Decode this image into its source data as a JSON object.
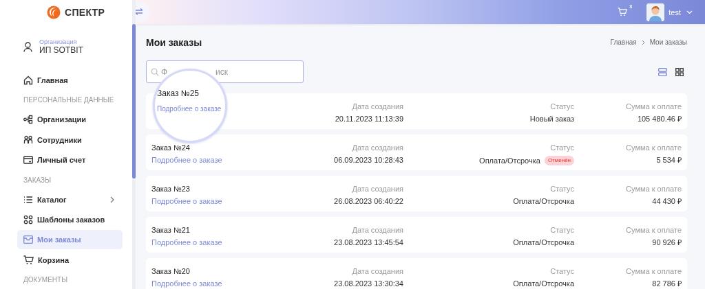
{
  "logo": {
    "text": "СПЕКТР"
  },
  "header": {
    "cart_count": "3",
    "user": "test"
  },
  "organization": {
    "label": "Организация",
    "name": "ИП SOTBIT"
  },
  "sidebar": {
    "items": [
      {
        "kind": "item",
        "label": "Главная",
        "selected": false,
        "expandable": false
      },
      {
        "kind": "section",
        "label": "ПЕРСОНАЛЬНЫЕ ДАННЫЕ"
      },
      {
        "kind": "item",
        "label": "Организации",
        "selected": false,
        "expandable": false
      },
      {
        "kind": "item",
        "label": "Сотрудники",
        "selected": false,
        "expandable": false
      },
      {
        "kind": "item",
        "label": "Личный счет",
        "selected": false,
        "expandable": false
      },
      {
        "kind": "section",
        "label": "ЗАКАЗЫ"
      },
      {
        "kind": "item",
        "label": "Каталог",
        "selected": false,
        "expandable": true
      },
      {
        "kind": "item",
        "label": "Шаблоны заказов",
        "selected": false,
        "expandable": false
      },
      {
        "kind": "item",
        "label": "Мои заказы",
        "selected": true,
        "expandable": false
      },
      {
        "kind": "item",
        "label": "Корзина",
        "selected": false,
        "expandable": false
      },
      {
        "kind": "section",
        "label": "ДОКУМЕНТЫ"
      }
    ]
  },
  "page": {
    "title": "Мои заказы",
    "breadcrumbs": [
      "Главная",
      "Мои заказы"
    ],
    "search": {
      "placeholder_parts": [
        "Ф",
        "иск"
      ]
    },
    "view_modes": [
      {
        "kind": "list",
        "selected": true
      },
      {
        "kind": "grid",
        "selected": false
      }
    ]
  },
  "orders": [
    {
      "title": "Заказ №25",
      "link": "Подробнее о заказе",
      "magnified": true,
      "date_label": "Дата создания",
      "date": "20.11.2023 11:13:39",
      "status_label": "Статус",
      "status": "Новый заказ",
      "sum_label": "Сумма к оплате",
      "sum": "105 480.46 ₽"
    },
    {
      "title": "Заказ №24",
      "link": "Подробнее о заказе",
      "magnified": false,
      "date_label": "Дата создания",
      "date": "06.09.2023 10:28:43",
      "status_label": "Статус",
      "status": "Оплата/Отсрочка",
      "badge": "Отменён",
      "sum_label": "Сумма к оплате",
      "sum": "5 534 ₽"
    },
    {
      "title": "Заказ №23",
      "link": "Подробнее о заказе",
      "magnified": false,
      "date_label": "Дата создания",
      "date": "26.08.2023 06:40:22",
      "status_label": "Статус",
      "status": "Оплата/Отсрочка",
      "sum_label": "Сумма к оплате",
      "sum": "44 430 ₽"
    },
    {
      "title": "Заказ №21",
      "link": "Подробнее о заказе",
      "magnified": false,
      "date_label": "Дата создания",
      "date": "23.08.2023 13:45:54",
      "status_label": "Статус",
      "status": "Оплата/Отсрочка",
      "sum_label": "Сумма к оплате",
      "sum": "90 926 ₽"
    },
    {
      "title": "Заказ №20",
      "link": "Подробнее о заказе",
      "magnified": false,
      "date_label": "Дата создания",
      "date": "23.08.2023 13:30:34",
      "status_label": "Статус",
      "status": "Оплата/Отсрочка",
      "sum_label": "Сумма к оплате",
      "sum": "82 786 ₽"
    }
  ]
}
